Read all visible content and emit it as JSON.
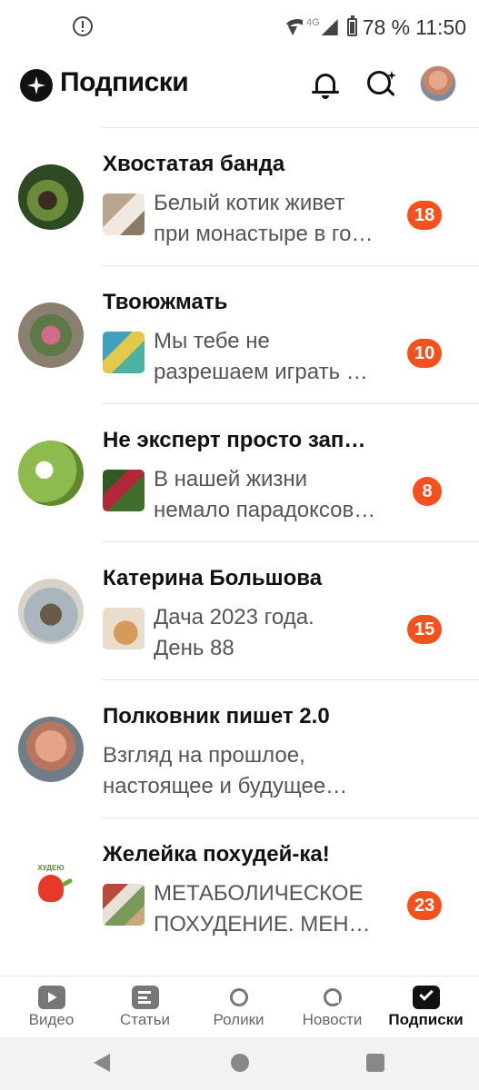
{
  "status_bar": {
    "network_label": "4G",
    "battery": "78 %",
    "time": "11:50",
    "icons": [
      "alert-icon",
      "wifi-icon",
      "signal-icon",
      "battery-icon"
    ]
  },
  "header": {
    "title": "Подписки",
    "icons": [
      "logo-icon",
      "bell-icon",
      "search-icon",
      "avatar"
    ]
  },
  "subscriptions": [
    {
      "name": "Хвостатая банда",
      "preview_line1": "Белый котик живет",
      "preview_line2": "при монастыре в го…",
      "count": "18",
      "has_thumb": true
    },
    {
      "name": "Твоюжмать",
      "preview_line1": "Мы тебе не",
      "preview_line2": "разрешаем играть …",
      "count": "10",
      "has_thumb": true
    },
    {
      "name": "Не эксперт просто зап…",
      "preview_line1": "В нашей жизни",
      "preview_line2": "немало парадоксов…",
      "count": "8",
      "has_thumb": true
    },
    {
      "name": "Катерина Большова",
      "preview_line1": "Дача 2023 года.",
      "preview_line2": "День 88",
      "count": "15",
      "has_thumb": true
    },
    {
      "name": "Полковник пишет 2.0",
      "preview_line1": "Взгляд на прошлое,",
      "preview_line2": "настоящее и будущее…",
      "count": "",
      "has_thumb": false
    },
    {
      "name": "Желейка похудей-ка!",
      "preview_line1": "МЕТАБОЛИЧЕСКОЕ",
      "preview_line2": "ПОХУДЕНИЕ. МЕН…",
      "count": "23",
      "has_thumb": true
    }
  ],
  "avatar_text": "ХУДЕЮ",
  "bottom_nav": {
    "items": [
      {
        "label": "Видео",
        "icon": "video-icon"
      },
      {
        "label": "Статьи",
        "icon": "articles-icon"
      },
      {
        "label": "Ролики",
        "icon": "clips-icon"
      },
      {
        "label": "Новости",
        "icon": "news-icon"
      },
      {
        "label": "Подписки",
        "icon": "subscriptions-icon"
      }
    ],
    "active": "Подписки"
  },
  "system_nav": {
    "icons": [
      "back-icon",
      "home-icon",
      "recents-icon"
    ]
  },
  "colors": {
    "badge": "#f4511e",
    "text_primary": "#111111",
    "text_secondary": "#555555"
  }
}
